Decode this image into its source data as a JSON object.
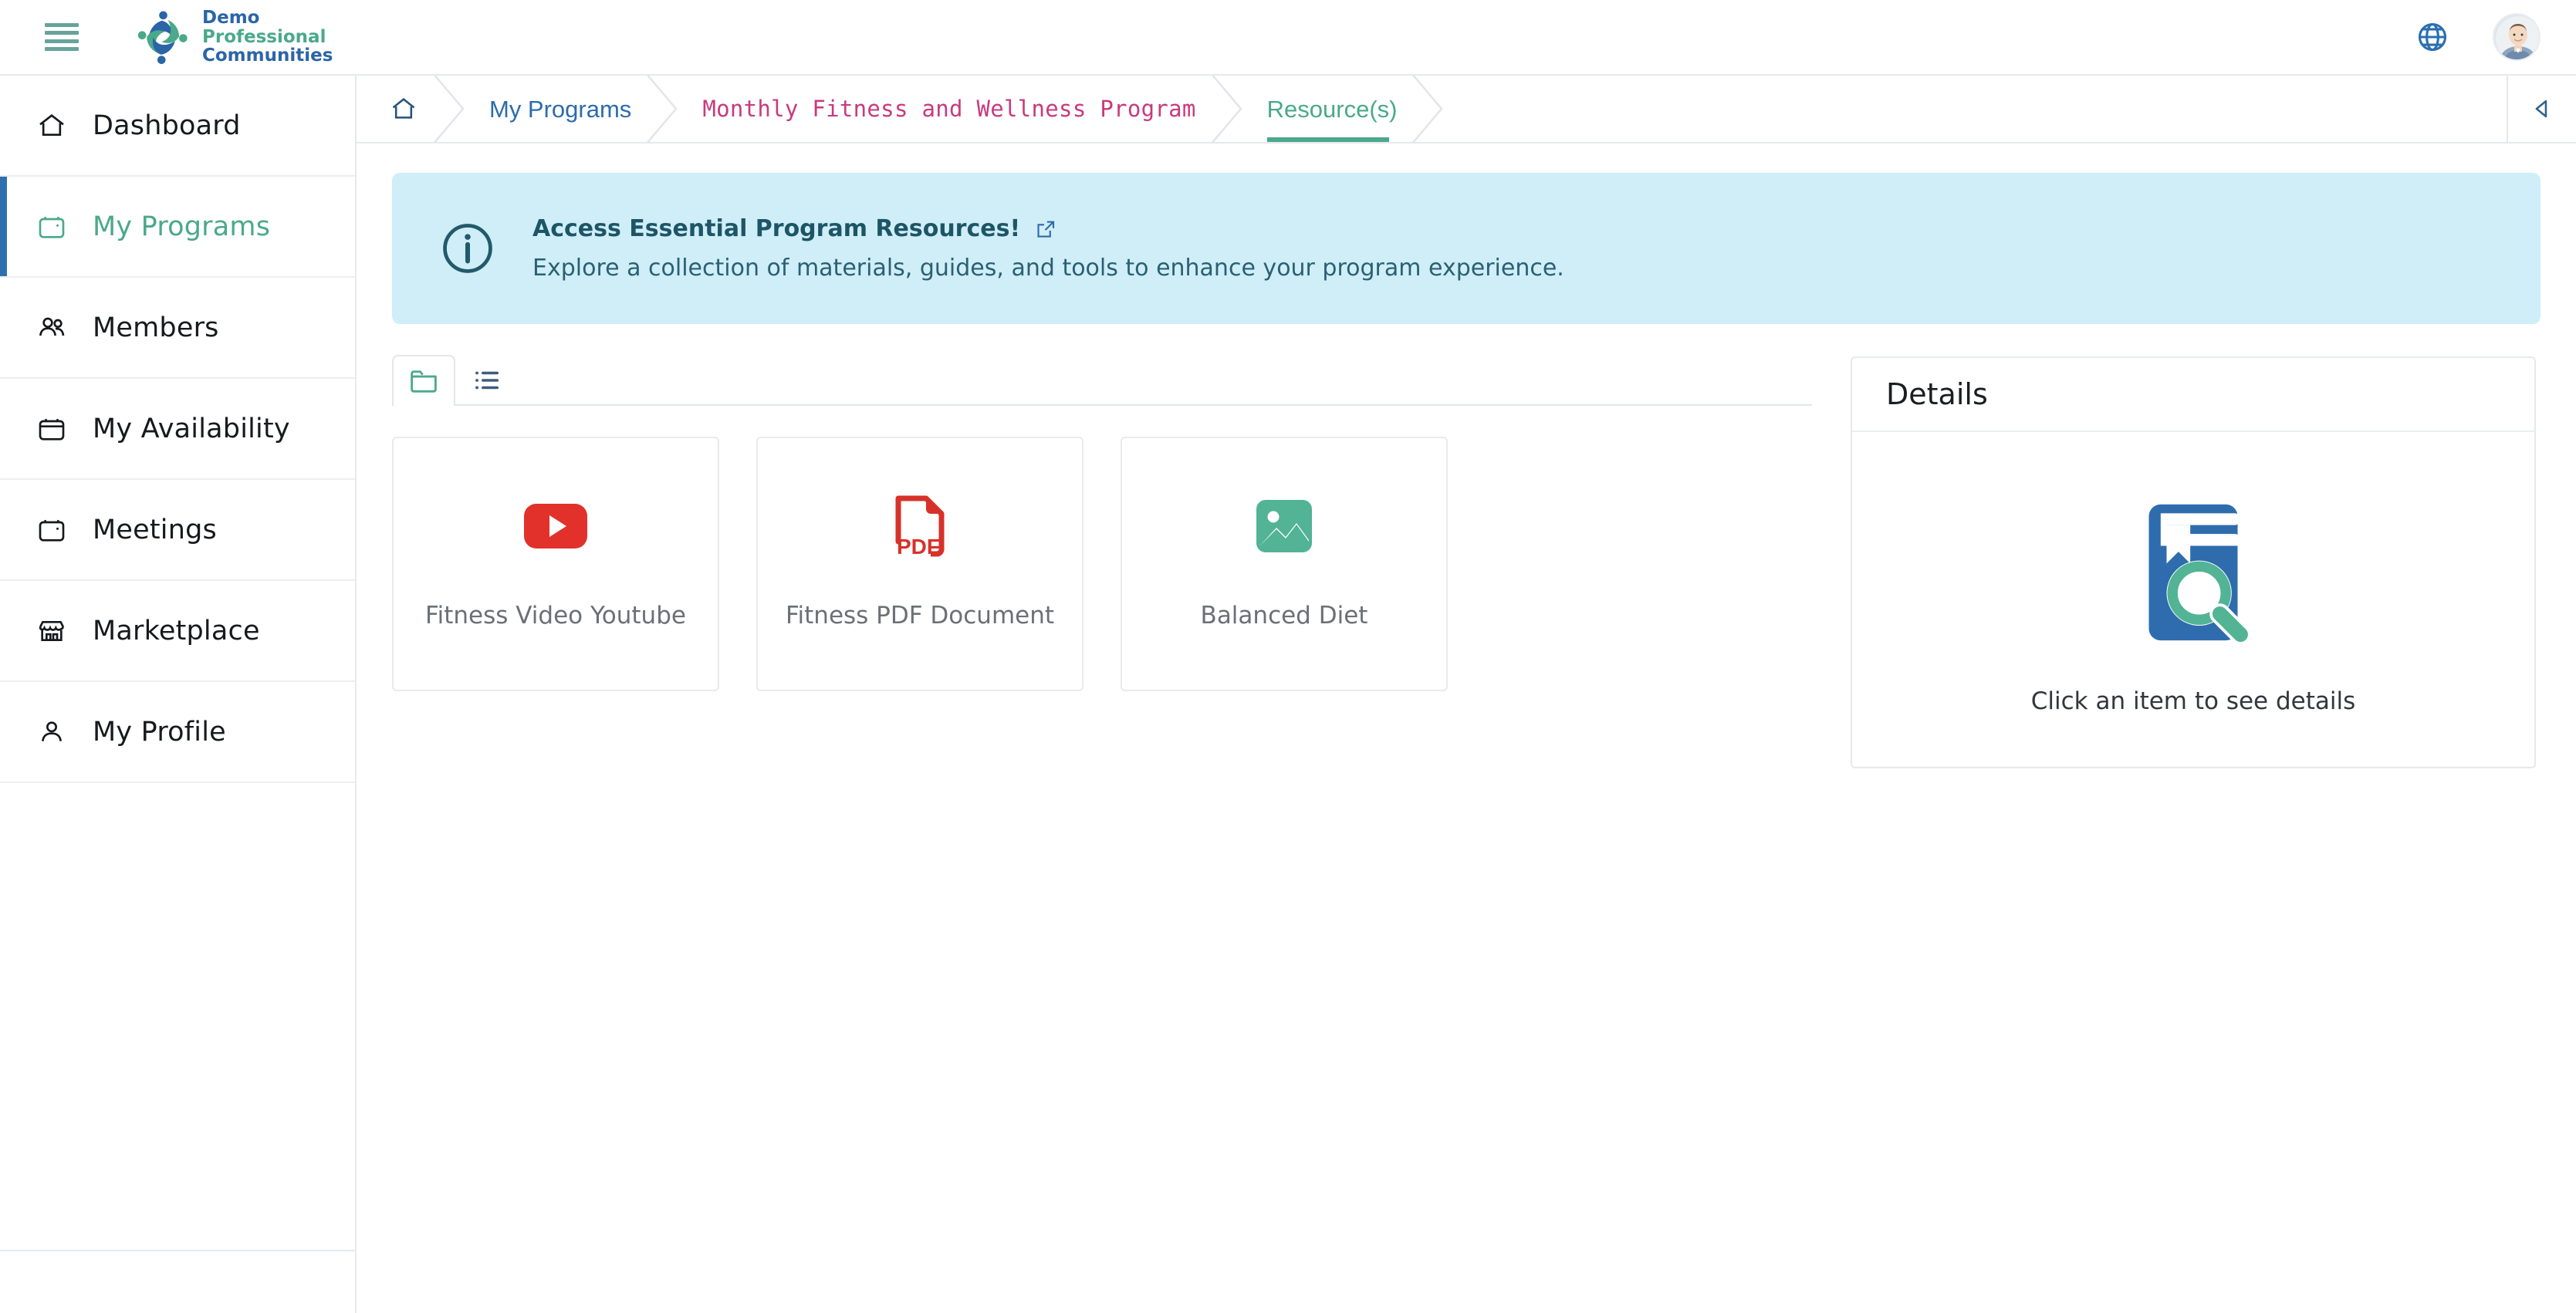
{
  "header": {
    "menu_label": "menu",
    "brand": {
      "line1": "Demo",
      "line2": "Professional",
      "line3": "Communities"
    },
    "language_icon": "globe-icon",
    "avatar_alt": "user avatar"
  },
  "sidebar": {
    "items": [
      {
        "label": "Dashboard",
        "icon": "home-icon",
        "active": false
      },
      {
        "label": "My Programs",
        "icon": "calendar-icon",
        "active": true
      },
      {
        "label": "Members",
        "icon": "users-icon",
        "active": false
      },
      {
        "label": "My Availability",
        "icon": "calendar-icon",
        "active": false
      },
      {
        "label": "Meetings",
        "icon": "calendar-icon",
        "active": false
      },
      {
        "label": "Marketplace",
        "icon": "storefront-icon",
        "active": false
      },
      {
        "label": "My Profile",
        "icon": "person-icon",
        "active": false
      }
    ]
  },
  "breadcrumb": {
    "home_icon": "home-icon",
    "items": [
      {
        "label": "My Programs",
        "state": "link"
      },
      {
        "label": "Monthly Fitness and Wellness Program",
        "state": "link"
      },
      {
        "label": "Resource(s)",
        "state": "active"
      }
    ],
    "collapse_icon": "caret-left-icon"
  },
  "banner": {
    "icon": "info-circle-icon",
    "title": "Access Essential Program Resources!",
    "link_icon": "external-link-icon",
    "subtitle": "Explore a collection of materials, guides, and tools to enhance your program experience."
  },
  "view_tabs": [
    {
      "icon": "folder-icon",
      "active": true
    },
    {
      "icon": "list-icon",
      "active": false
    }
  ],
  "resources": [
    {
      "label": "Fitness Video Youtube",
      "icon": "youtube-icon"
    },
    {
      "label": "Fitness PDF Document",
      "icon": "pdf-icon"
    },
    {
      "label": "Balanced Diet",
      "icon": "image-icon"
    }
  ],
  "details": {
    "title": "Details",
    "empty_icon": "book-search-icon",
    "empty_text": "Click an item to see details"
  },
  "colors": {
    "accent_green": "#4aa98a",
    "accent_blue": "#2c6cab",
    "accent_pink": "#c83a7e",
    "banner_bg": "#cfeef8",
    "banner_fg": "#1d5566",
    "active_bar": "#2f6fad",
    "pdf_red": "#d7312a",
    "youtube_red": "#e3342f"
  }
}
